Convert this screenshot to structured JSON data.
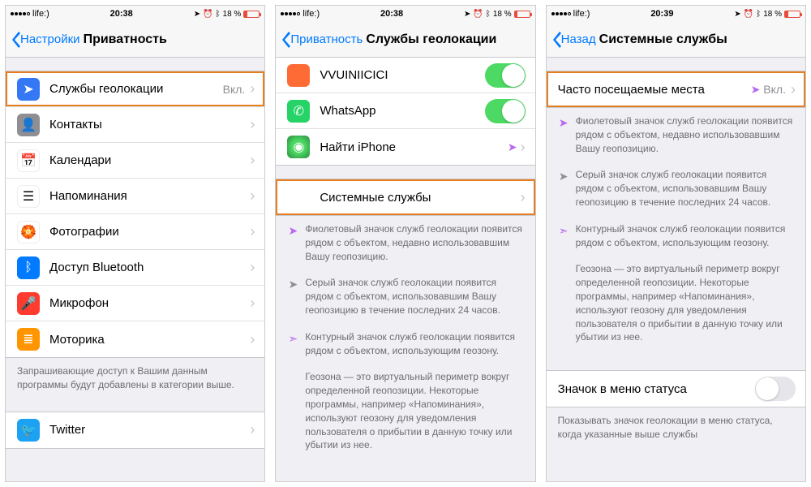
{
  "statusbar": {
    "carrier": "life:)",
    "time1": "20:38",
    "time2": "20:39",
    "battery": "18 %"
  },
  "screen1": {
    "back": "Настройки",
    "title": "Приватность",
    "rows": {
      "location": {
        "label": "Службы геолокации",
        "value": "Вкл."
      },
      "contacts": {
        "label": "Контакты"
      },
      "calendars": {
        "label": "Календари"
      },
      "reminders": {
        "label": "Напоминания"
      },
      "photos": {
        "label": "Фотографии"
      },
      "bluetooth": {
        "label": "Доступ Bluetooth"
      },
      "microphone": {
        "label": "Микрофон"
      },
      "motion": {
        "label": "Моторика"
      }
    },
    "footer": "Запрашивающие доступ к Вашим данным программы будут добавлены в категории выше.",
    "twitter": "Twitter"
  },
  "screen2": {
    "back": "Приватность",
    "title": "Службы геолокации",
    "apps": {
      "walkmeter": "VVUINIICICI",
      "whatsapp": "WhatsApp",
      "findiphone": "Найти iPhone"
    },
    "system": "Системные службы",
    "info1": "Фиолетовый значок служб геолокации появится рядом с объектом, недавно использовавшим Вашу геопозицию.",
    "info2": "Серый значок служб геолокации появится рядом с объектом, использовавшим Вашу геопозицию в течение последних 24 часов.",
    "info3": "Контурный значок служб геолокации появится рядом с объектом, использующим геозону.",
    "info4": "Геозона — это виртуальный периметр вокруг определенной геопозиции. Некоторые программы, например «Напоминания», используют геозону для уведомления пользователя о прибытии в данную точку или убытии из нее."
  },
  "screen3": {
    "back": "Назад",
    "title": "Системные службы",
    "frequent": {
      "label": "Часто посещаемые места",
      "value": "Вкл."
    },
    "info1": "Фиолетовый значок служб геолокации появится рядом с объектом, недавно использовавшим Вашу геопозицию.",
    "info2": "Серый значок служб геолокации появится рядом с объектом, использовавшим Вашу геопозицию в течение последних 24 часов.",
    "info3": "Контурный значок служб геолокации появится рядом с объектом, использующим геозону.",
    "info4": "Геозона — это виртуальный периметр вокруг определенной геопозиции. Некоторые программы, например «Напоминания», используют геозону для уведомления пользователя о прибытии в данную точку или убытии из нее.",
    "statusicon": "Значок в меню статуса",
    "statusfooter": "Показывать значок геолокации в меню статуса, когда указанные выше службы"
  }
}
